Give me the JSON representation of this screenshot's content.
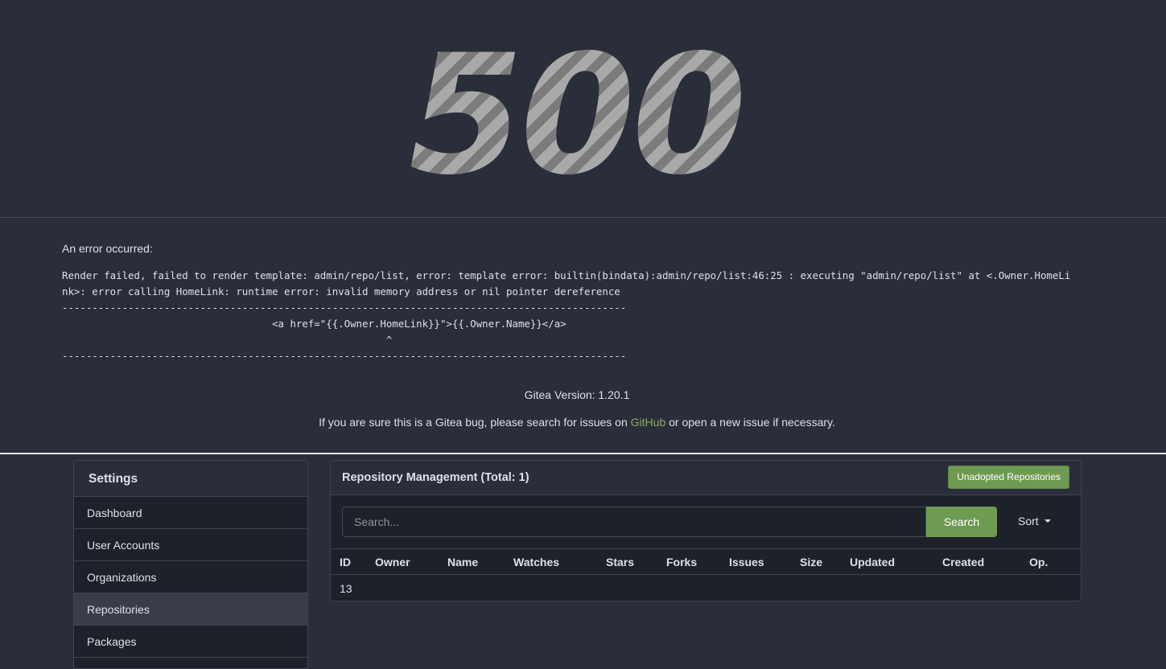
{
  "error": {
    "code": "500",
    "label": "An error occurred:",
    "detail": "Render failed, failed to render template: admin/repo/list, error: template error: builtin(bindata):admin/repo/list:46:25 : executing \"admin/repo/list\" at <.Owner.HomeLi\nnk>: error calling HomeLink: runtime error: invalid memory address or nil pointer dereference\n----------------------------------------------------------------------------------------------\n                                   <a href=\"{{.Owner.HomeLink}}\">{{.Owner.Name}}</a>\n                                                      ^\n----------------------------------------------------------------------------------------------",
    "version": "Gitea Version: 1.20.1",
    "bug_note_prefix": "If you are sure this is a Gitea bug, please search for issues on ",
    "bug_note_link": "GitHub",
    "bug_note_suffix": " or open a new issue if necessary."
  },
  "sidebar": {
    "title": "Settings",
    "items": [
      {
        "label": "Dashboard",
        "active": false
      },
      {
        "label": "User Accounts",
        "active": false
      },
      {
        "label": "Organizations",
        "active": false
      },
      {
        "label": "Repositories",
        "active": true
      },
      {
        "label": "Packages",
        "active": false
      }
    ]
  },
  "repo_panel": {
    "title": "Repository Management (Total: 1)",
    "unadopted_label": "Unadopted Repositories",
    "search_placeholder": "Search...",
    "search_value": "",
    "search_button": "Search",
    "sort_label": "Sort",
    "columns": [
      "ID",
      "Owner",
      "Name",
      "Watches",
      "Stars",
      "Forks",
      "Issues",
      "Size",
      "Updated",
      "Created",
      "Op."
    ],
    "rows": [
      {
        "id": "13"
      }
    ]
  },
  "colors": {
    "background": "#2a2e3a",
    "accent_green": "#6e9a51",
    "link_green": "#87ab63",
    "text": "#dbe0ea",
    "code_stripe_light": "#a9a9a9",
    "code_stripe_dark": "#7b7b7b"
  }
}
